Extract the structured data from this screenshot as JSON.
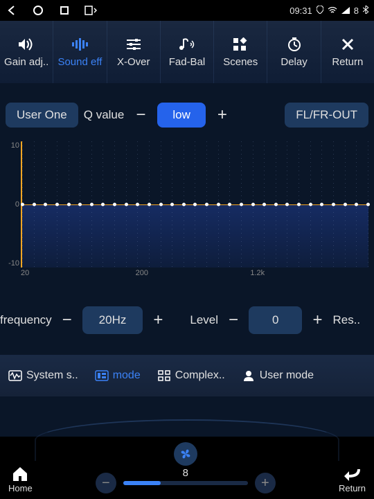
{
  "status": {
    "time": "09:31",
    "bt_level": "8"
  },
  "toolbar": {
    "items": [
      {
        "label": "Gain adj.."
      },
      {
        "label": "Sound eff"
      },
      {
        "label": "X-Over"
      },
      {
        "label": "Fad-Bal"
      },
      {
        "label": "Scenes"
      },
      {
        "label": "Delay"
      },
      {
        "label": "Return"
      }
    ]
  },
  "controls": {
    "user_label": "User One",
    "q_label": "Q value",
    "q_value": "low",
    "output": "FL/FR-OUT"
  },
  "chart_data": {
    "type": "line",
    "title": "",
    "xlabel": "",
    "ylabel": "",
    "ylim": [
      -10,
      10
    ],
    "x_ticks": [
      "20",
      "200",
      "1.2k"
    ],
    "y_ticks": [
      "10",
      "0",
      "-10"
    ],
    "bands": 31,
    "values": [
      0,
      0,
      0,
      0,
      0,
      0,
      0,
      0,
      0,
      0,
      0,
      0,
      0,
      0,
      0,
      0,
      0,
      0,
      0,
      0,
      0,
      0,
      0,
      0,
      0,
      0,
      0,
      0,
      0,
      0,
      0
    ]
  },
  "freq": {
    "freq_label": "frequency",
    "freq_value": "20Hz",
    "level_label": "Level",
    "level_value": "0",
    "res_label": "Res.."
  },
  "modes": {
    "items": [
      {
        "label": "System s.."
      },
      {
        "label": "mode"
      },
      {
        "label": "Complex.."
      },
      {
        "label": "User mode"
      }
    ]
  },
  "bottom": {
    "home": "Home",
    "return": "Return",
    "volume": "8"
  }
}
